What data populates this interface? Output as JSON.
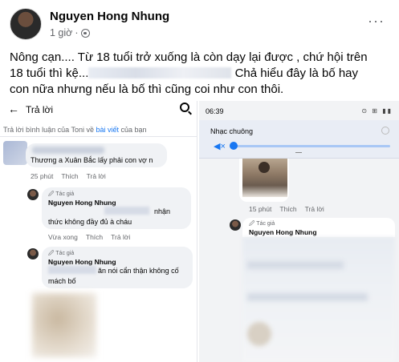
{
  "post": {
    "author": "Nguyen Hong Nhung",
    "time": "1 giờ",
    "more": "···",
    "text_line1": "Nông cạn.... Từ 18 tuổi trở xuống là còn dạy lại được , chứ hội trên",
    "text_line2_start": "18 tuổi thì kệ...",
    "text_line2_end": " Chả hiểu đây là bố hay",
    "text_line3": "con nữa nhưng nếu là bố thì cũng coi như con thôi."
  },
  "left_screenshot": {
    "back_icon": "arrow-left-icon",
    "title": "Trả lời",
    "search_icon": "search-icon",
    "reply_info_prefix": "Trả lời bình luận của Toni về ",
    "reply_info_link": "bài viết",
    "reply_info_suffix": " của bạn",
    "comment1": {
      "text": "Thương a Xuân Bắc lấy phải con vợ n",
      "time": "25 phút",
      "like": "Thích",
      "reply": "Trả lời"
    },
    "comment2": {
      "badge": "🖉 Tác giả",
      "name": "Nguyen Hong Nhung",
      "text_a": "nhận",
      "text_b": "thức không đầy đủ à cháu",
      "time": "Vừa xong",
      "like": "Thích",
      "reply": "Trả lời"
    },
    "comment3": {
      "badge": "🖉 Tác giả",
      "name": "Nguyen Hong Nhung",
      "text_a": "ăn nói cẩn thận không cố",
      "text_b": "mách bố"
    }
  },
  "right_screenshot": {
    "status_time": "06:39",
    "status_icons": "⊙ ⊞ ▮▮",
    "ringtone_label": "Nhạc chuông",
    "volume_icon": "speaker-mute-icon",
    "volume_level": 0,
    "photo_comment": {
      "time": "15 phút",
      "like": "Thích",
      "reply": "Trả lời"
    },
    "author_comment": {
      "badge": "🖉 Tác giả",
      "name": "Nguyen Hong Nhung"
    }
  }
}
